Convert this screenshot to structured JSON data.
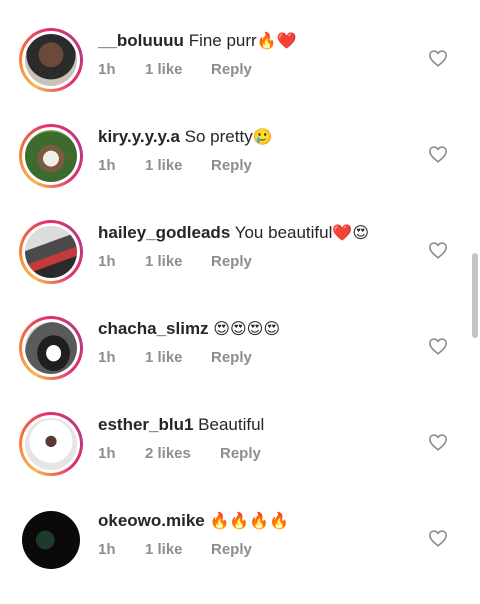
{
  "comments": [
    {
      "username": "__boluuuu",
      "text": "Fine purr",
      "emoji": "🔥❤️",
      "time": "1h",
      "likes": "1 like",
      "reply": "Reply"
    },
    {
      "username": "kiry.y.y.y.a",
      "text": "So pretty",
      "emoji": "🥲",
      "time": "1h",
      "likes": "1 like",
      "reply": "Reply"
    },
    {
      "username": "hailey_godleads",
      "text": "You beautiful",
      "emoji": "❤️😍",
      "time": "1h",
      "likes": "1 like",
      "reply": "Reply"
    },
    {
      "username": "chacha_slimz",
      "text": "",
      "emoji": "😍😍😍😍",
      "time": "1h",
      "likes": "1 like",
      "reply": "Reply"
    },
    {
      "username": "esther_blu1",
      "text": "Beautiful",
      "emoji": "",
      "time": "1h",
      "likes": "2 likes",
      "reply": "Reply"
    },
    {
      "username": "okeowo.mike",
      "text": "",
      "emoji": "🔥🔥🔥🔥",
      "time": "1h",
      "likes": "1 like",
      "reply": "Reply"
    }
  ],
  "icons": {
    "like": "heart-outline-icon"
  },
  "colors": {
    "username": "#262626",
    "meta": "#8e8e8e",
    "story_ring": "#e1306c"
  }
}
